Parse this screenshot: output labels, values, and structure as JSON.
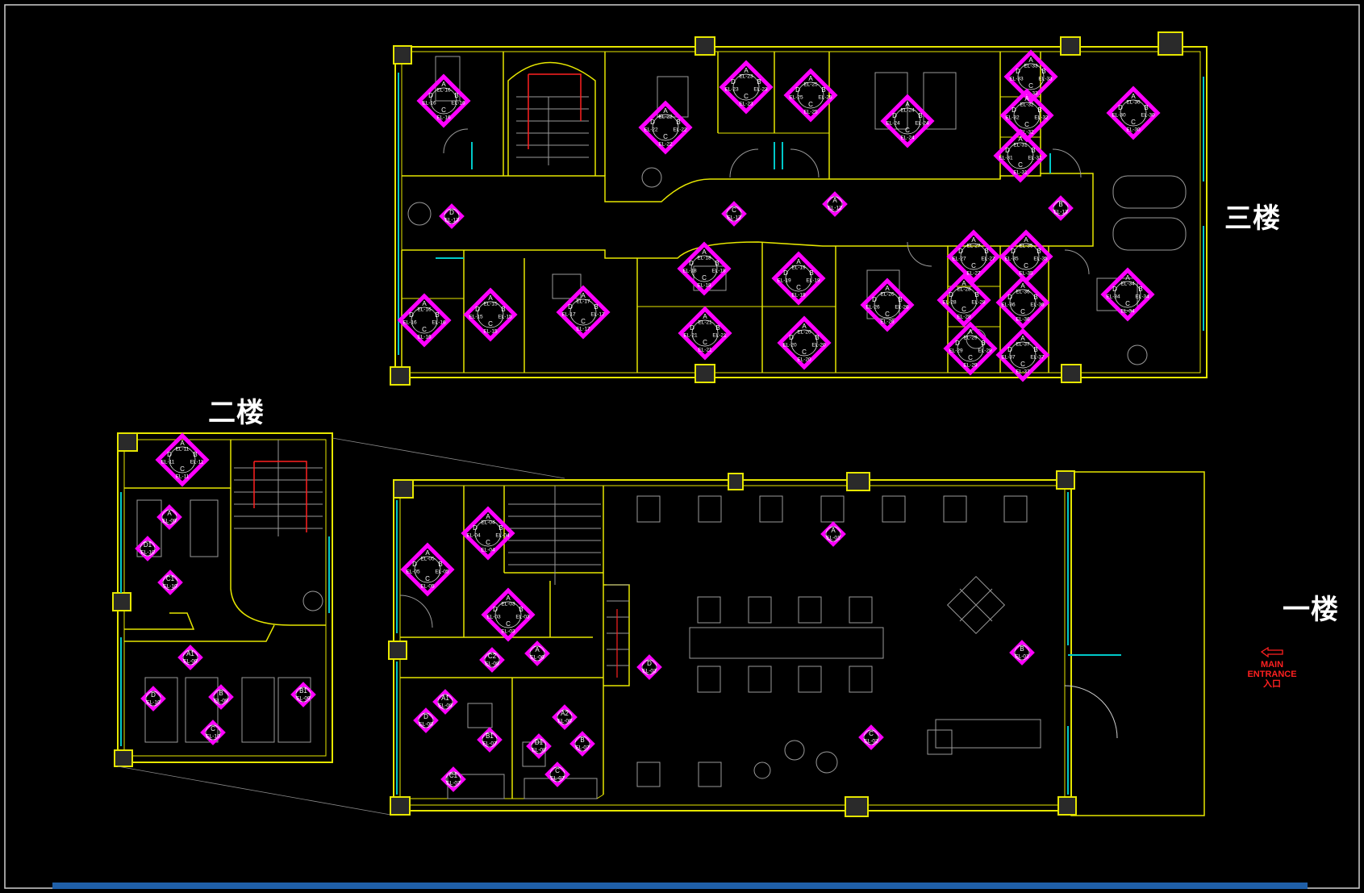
{
  "floor_labels": {
    "third": "三楼",
    "second": "二楼",
    "first": "一楼"
  },
  "entrance": {
    "line1": "MAIN",
    "line2": "ENTRANCE",
    "line3": "入口"
  },
  "colors": {
    "background": "#000000",
    "wall": "#e6e600",
    "window": "#00c8c8",
    "marker": "#ff00ff",
    "furniture": "#9a9a9a",
    "stair_arrow": "#ff2020",
    "entrance": "#ff2020",
    "label": "#ffffff",
    "scrollbar": "#1f5fa8"
  },
  "markers_third": [
    {
      "id": "EL-16",
      "letters": [
        "A",
        "B",
        "C",
        "D"
      ]
    },
    {
      "id": "EL-22",
      "letters": [
        "A",
        "B",
        "C",
        "D"
      ]
    },
    {
      "id": "EL-23",
      "letters": [
        "A",
        "B",
        "C",
        "D"
      ]
    },
    {
      "id": "EL-25",
      "letters": [
        "A",
        "B",
        "C",
        "D"
      ]
    },
    {
      "id": "EL-24",
      "letters": [
        "A",
        "B",
        "C",
        "D"
      ]
    },
    {
      "id": "EL-33",
      "letters": [
        "A",
        "B",
        "C",
        "D"
      ]
    },
    {
      "id": "EL-32",
      "letters": [
        "A",
        "B",
        "C",
        "D"
      ]
    },
    {
      "id": "EL-31",
      "letters": [
        "A",
        "B",
        "C",
        "D"
      ]
    },
    {
      "id": "EL-30",
      "letters": [
        "A",
        "B",
        "C",
        "D"
      ]
    },
    {
      "id": "EL-15",
      "letters": [
        "A",
        "B",
        "C",
        "D"
      ]
    },
    {
      "id": "EL-16",
      "letters": [
        "A",
        "B",
        "C",
        "D"
      ]
    },
    {
      "id": "EL-17",
      "letters": [
        "A",
        "B",
        "C",
        "D"
      ]
    },
    {
      "id": "EL-18",
      "letters": [
        "A",
        "B",
        "C",
        "D"
      ]
    },
    {
      "id": "EL-19",
      "letters": [
        "A",
        "B",
        "C",
        "D"
      ]
    },
    {
      "id": "EL-21",
      "letters": [
        "A",
        "B",
        "C",
        "D"
      ]
    },
    {
      "id": "EL-20",
      "letters": [
        "A",
        "B",
        "C",
        "D"
      ]
    },
    {
      "id": "EL-26",
      "letters": [
        "A",
        "B",
        "C",
        "D"
      ]
    },
    {
      "id": "EL-27",
      "letters": [
        "A",
        "B",
        "C",
        "D"
      ]
    },
    {
      "id": "EL-35",
      "letters": [
        "A",
        "B",
        "C",
        "D"
      ]
    },
    {
      "id": "EL-28",
      "letters": [
        "A",
        "B",
        "C",
        "D"
      ]
    },
    {
      "id": "EL-36",
      "letters": [
        "A",
        "B",
        "C",
        "D"
      ]
    },
    {
      "id": "EL-29",
      "letters": [
        "A",
        "B",
        "C",
        "D"
      ]
    },
    {
      "id": "EL-37",
      "letters": [
        "A",
        "B",
        "C",
        "D"
      ]
    },
    {
      "id": "EL-34",
      "letters": [
        "A",
        "B",
        "C",
        "D"
      ]
    }
  ],
  "markers_third_single": [
    {
      "letter": "D",
      "id": "EL-13"
    },
    {
      "letter": "C",
      "id": "EL-12"
    },
    {
      "letter": "A",
      "id": "EL-12"
    },
    {
      "letter": "B",
      "id": "EL-13"
    }
  ],
  "markers_second": [
    {
      "id": "EL-11",
      "letters": [
        "A",
        "B",
        "C",
        "D"
      ]
    }
  ],
  "markers_second_single": [
    {
      "letter": "A",
      "id": "EL-09"
    },
    {
      "letter": "D1",
      "id": "EL-10"
    },
    {
      "letter": "C1",
      "id": "EL-10"
    },
    {
      "letter": "A1",
      "id": "EL-09"
    },
    {
      "letter": "D",
      "id": "EL-10"
    },
    {
      "letter": "B",
      "id": "EL-09"
    },
    {
      "letter": "B1",
      "id": "EL-09"
    },
    {
      "letter": "C",
      "id": "EL-10"
    }
  ],
  "markers_first": [
    {
      "id": "EL-04",
      "letters": [
        "A",
        "B",
        "C",
        "D"
      ]
    },
    {
      "id": "EL-05",
      "letters": [
        "A",
        "B",
        "C",
        "D"
      ]
    },
    {
      "id": "EL-03",
      "letters": [
        "A",
        "B",
        "C",
        "D"
      ]
    }
  ],
  "markers_first_single": [
    {
      "letter": "A",
      "id": "EL-01"
    },
    {
      "letter": "C2",
      "id": "EL-08"
    },
    {
      "letter": "A",
      "id": "EL-06"
    },
    {
      "letter": "D",
      "id": "EL-02"
    },
    {
      "letter": "B",
      "id": "EL-01"
    },
    {
      "letter": "A1",
      "id": "EL-08"
    },
    {
      "letter": "D",
      "id": "EL-08"
    },
    {
      "letter": "A2",
      "id": "EL-06"
    },
    {
      "letter": "B1",
      "id": "EL-07"
    },
    {
      "letter": "D1",
      "id": "EL-08"
    },
    {
      "letter": "B",
      "id": "EL-07"
    },
    {
      "letter": "C",
      "id": "EL-07"
    },
    {
      "letter": "C1",
      "id": "EL-07"
    },
    {
      "letter": "C",
      "id": "EL-02"
    }
  ]
}
